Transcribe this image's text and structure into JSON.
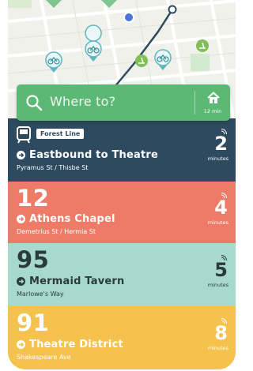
{
  "search": {
    "placeholder": "Where to?",
    "home_eta": "12 min"
  },
  "departures": [
    {
      "route": "Forest Line",
      "destination": "Eastbound to Theatre",
      "stop": "Pyramus St / Thisbe St",
      "minutes": "2",
      "minutes_label": "minutes",
      "color": "#2d4a5e"
    },
    {
      "route": "12",
      "destination": "Athens Chapel",
      "stop": "Demetrius St / Hermia St",
      "minutes": "4",
      "minutes_label": "minutes",
      "color": "#ee7b67"
    },
    {
      "route": "95",
      "destination": "Mermaid Tavern",
      "stop": "Marlowe's Way",
      "minutes": "5",
      "minutes_label": "minutes",
      "color": "#a8d9cf"
    },
    {
      "route": "91",
      "destination": "Theatre District",
      "stop": "Shakespeare Ave",
      "minutes": "8",
      "minutes_label": "minutes",
      "color": "#f4c24d"
    }
  ],
  "map": {
    "icons": [
      "bike-share-icon",
      "scooter-icon",
      "current-location-icon",
      "transit-stop-icon"
    ]
  }
}
